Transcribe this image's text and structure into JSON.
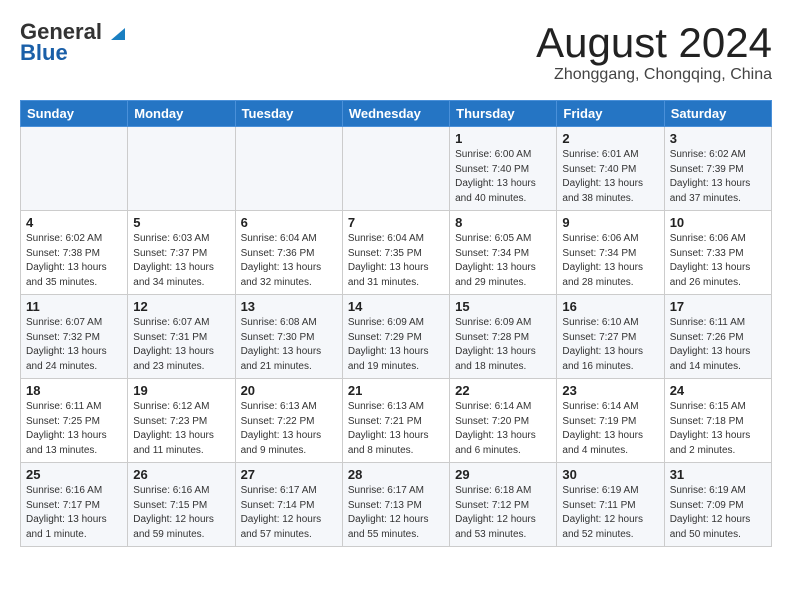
{
  "header": {
    "logo_general": "General",
    "logo_blue": "Blue",
    "title": "August 2024",
    "location": "Zhonggang, Chongqing, China"
  },
  "weekdays": [
    "Sunday",
    "Monday",
    "Tuesday",
    "Wednesday",
    "Thursday",
    "Friday",
    "Saturday"
  ],
  "weeks": [
    [
      {
        "day": "",
        "info": ""
      },
      {
        "day": "",
        "info": ""
      },
      {
        "day": "",
        "info": ""
      },
      {
        "day": "",
        "info": ""
      },
      {
        "day": "1",
        "info": "Sunrise: 6:00 AM\nSunset: 7:40 PM\nDaylight: 13 hours\nand 40 minutes."
      },
      {
        "day": "2",
        "info": "Sunrise: 6:01 AM\nSunset: 7:40 PM\nDaylight: 13 hours\nand 38 minutes."
      },
      {
        "day": "3",
        "info": "Sunrise: 6:02 AM\nSunset: 7:39 PM\nDaylight: 13 hours\nand 37 minutes."
      }
    ],
    [
      {
        "day": "4",
        "info": "Sunrise: 6:02 AM\nSunset: 7:38 PM\nDaylight: 13 hours\nand 35 minutes."
      },
      {
        "day": "5",
        "info": "Sunrise: 6:03 AM\nSunset: 7:37 PM\nDaylight: 13 hours\nand 34 minutes."
      },
      {
        "day": "6",
        "info": "Sunrise: 6:04 AM\nSunset: 7:36 PM\nDaylight: 13 hours\nand 32 minutes."
      },
      {
        "day": "7",
        "info": "Sunrise: 6:04 AM\nSunset: 7:35 PM\nDaylight: 13 hours\nand 31 minutes."
      },
      {
        "day": "8",
        "info": "Sunrise: 6:05 AM\nSunset: 7:34 PM\nDaylight: 13 hours\nand 29 minutes."
      },
      {
        "day": "9",
        "info": "Sunrise: 6:06 AM\nSunset: 7:34 PM\nDaylight: 13 hours\nand 28 minutes."
      },
      {
        "day": "10",
        "info": "Sunrise: 6:06 AM\nSunset: 7:33 PM\nDaylight: 13 hours\nand 26 minutes."
      }
    ],
    [
      {
        "day": "11",
        "info": "Sunrise: 6:07 AM\nSunset: 7:32 PM\nDaylight: 13 hours\nand 24 minutes."
      },
      {
        "day": "12",
        "info": "Sunrise: 6:07 AM\nSunset: 7:31 PM\nDaylight: 13 hours\nand 23 minutes."
      },
      {
        "day": "13",
        "info": "Sunrise: 6:08 AM\nSunset: 7:30 PM\nDaylight: 13 hours\nand 21 minutes."
      },
      {
        "day": "14",
        "info": "Sunrise: 6:09 AM\nSunset: 7:29 PM\nDaylight: 13 hours\nand 19 minutes."
      },
      {
        "day": "15",
        "info": "Sunrise: 6:09 AM\nSunset: 7:28 PM\nDaylight: 13 hours\nand 18 minutes."
      },
      {
        "day": "16",
        "info": "Sunrise: 6:10 AM\nSunset: 7:27 PM\nDaylight: 13 hours\nand 16 minutes."
      },
      {
        "day": "17",
        "info": "Sunrise: 6:11 AM\nSunset: 7:26 PM\nDaylight: 13 hours\nand 14 minutes."
      }
    ],
    [
      {
        "day": "18",
        "info": "Sunrise: 6:11 AM\nSunset: 7:25 PM\nDaylight: 13 hours\nand 13 minutes."
      },
      {
        "day": "19",
        "info": "Sunrise: 6:12 AM\nSunset: 7:23 PM\nDaylight: 13 hours\nand 11 minutes."
      },
      {
        "day": "20",
        "info": "Sunrise: 6:13 AM\nSunset: 7:22 PM\nDaylight: 13 hours\nand 9 minutes."
      },
      {
        "day": "21",
        "info": "Sunrise: 6:13 AM\nSunset: 7:21 PM\nDaylight: 13 hours\nand 8 minutes."
      },
      {
        "day": "22",
        "info": "Sunrise: 6:14 AM\nSunset: 7:20 PM\nDaylight: 13 hours\nand 6 minutes."
      },
      {
        "day": "23",
        "info": "Sunrise: 6:14 AM\nSunset: 7:19 PM\nDaylight: 13 hours\nand 4 minutes."
      },
      {
        "day": "24",
        "info": "Sunrise: 6:15 AM\nSunset: 7:18 PM\nDaylight: 13 hours\nand 2 minutes."
      }
    ],
    [
      {
        "day": "25",
        "info": "Sunrise: 6:16 AM\nSunset: 7:17 PM\nDaylight: 13 hours\nand 1 minute."
      },
      {
        "day": "26",
        "info": "Sunrise: 6:16 AM\nSunset: 7:15 PM\nDaylight: 12 hours\nand 59 minutes."
      },
      {
        "day": "27",
        "info": "Sunrise: 6:17 AM\nSunset: 7:14 PM\nDaylight: 12 hours\nand 57 minutes."
      },
      {
        "day": "28",
        "info": "Sunrise: 6:17 AM\nSunset: 7:13 PM\nDaylight: 12 hours\nand 55 minutes."
      },
      {
        "day": "29",
        "info": "Sunrise: 6:18 AM\nSunset: 7:12 PM\nDaylight: 12 hours\nand 53 minutes."
      },
      {
        "day": "30",
        "info": "Sunrise: 6:19 AM\nSunset: 7:11 PM\nDaylight: 12 hours\nand 52 minutes."
      },
      {
        "day": "31",
        "info": "Sunrise: 6:19 AM\nSunset: 7:09 PM\nDaylight: 12 hours\nand 50 minutes."
      }
    ]
  ]
}
